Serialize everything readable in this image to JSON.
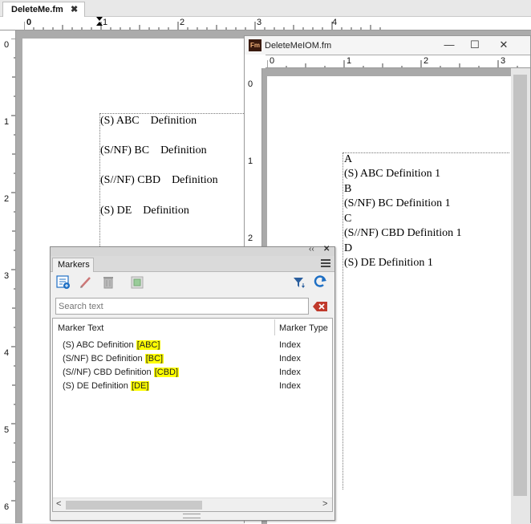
{
  "main_window": {
    "tab_title": "DeleteMe.fm",
    "tab_close": "✖",
    "ruler_numbers": [
      "0",
      "1",
      "2",
      "3",
      "4"
    ],
    "vruler_numbers": [
      "0",
      "1",
      "2",
      "3",
      "4",
      "5",
      "6"
    ],
    "document_lines": [
      "(S) ABC    Definition",
      "(S/NF) BC    Definition",
      "(S//NF) CBD    Definition",
      "(S) DE    Definition"
    ]
  },
  "second_window": {
    "title": "DeleteMeIOM.fm",
    "icon_label": "Fm",
    "min_glyph": "—",
    "max_glyph": "☐",
    "close_glyph": "✕",
    "ruler_numbers": [
      "0",
      "1",
      "2",
      "3"
    ],
    "vruler_numbers": [
      "0",
      "1",
      "2"
    ],
    "index_lines": [
      "A",
      "(S) ABC Definition 1",
      "B",
      "(S/NF) BC Definition 1",
      "C",
      "(S//NF) CBD Definition 1",
      "D",
      "(S) DE Definition 1"
    ]
  },
  "markers_panel": {
    "collapse_glyph": "‹‹",
    "close_glyph": "✕",
    "tab_label": "Markers",
    "search_placeholder": "Search text",
    "columns": {
      "marker_text": "Marker Text",
      "marker_type": "Marker Type"
    },
    "rows": [
      {
        "text": "(S) ABC Definition ",
        "highlight": "[ABC]",
        "type": "Index"
      },
      {
        "text": "(S/NF) BC Definition ",
        "highlight": "[BC]",
        "type": "Index"
      },
      {
        "text": "(S//NF) CBD Definition ",
        "highlight": "[CBD]",
        "type": "Index"
      },
      {
        "text": "(S) DE Definition ",
        "highlight": "[DE]",
        "type": "Index"
      }
    ],
    "scroll_left": "<",
    "scroll_right": ">",
    "highlight_color": "#ffff00",
    "refresh_color": "#1e6fc4",
    "clear_color": "#c0392b"
  }
}
